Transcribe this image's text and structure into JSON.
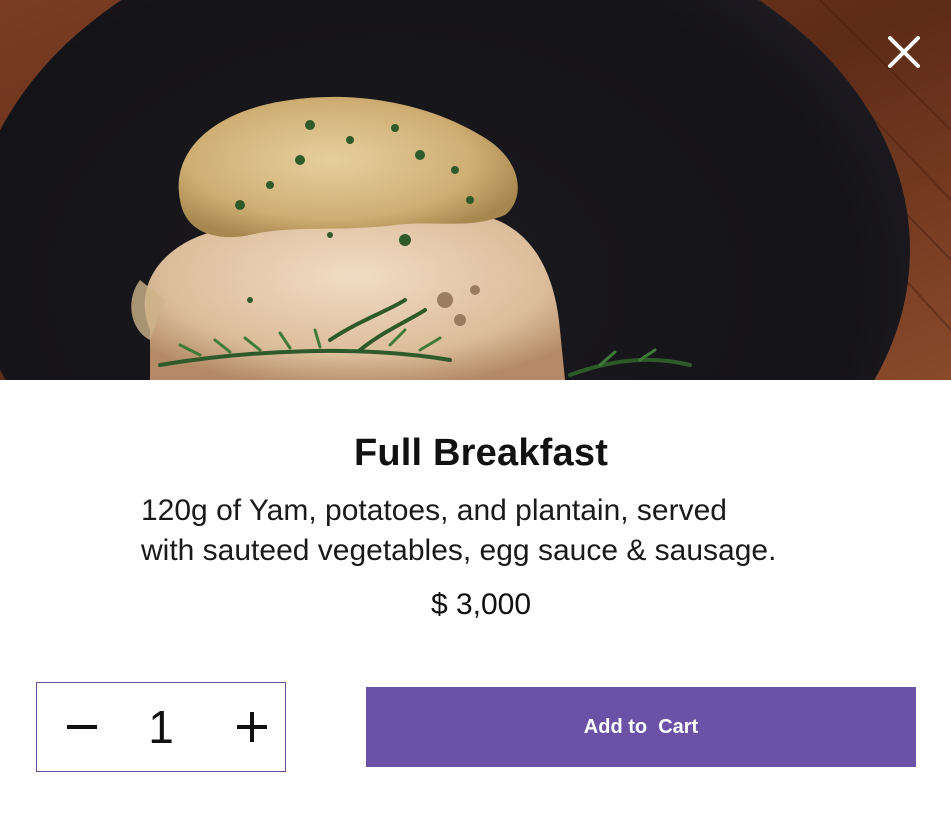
{
  "product": {
    "image_alt": "Plate of food with sauce and rosemary",
    "title": "Full Breakfast",
    "description_line1": "120g of Yam, potatoes, and plantain, served",
    "description_line2": "with sauteed vegetables, egg sauce & sausage.",
    "price": "$ 3,000"
  },
  "quantity": {
    "value": "1",
    "decrement_icon": "minus-icon",
    "increment_icon": "plus-icon"
  },
  "actions": {
    "add_to_cart_label": "Add to  Cart",
    "close_icon": "close-icon"
  },
  "colors": {
    "accent": "#6b52a6",
    "stepper_border": "#6a4c9c"
  }
}
